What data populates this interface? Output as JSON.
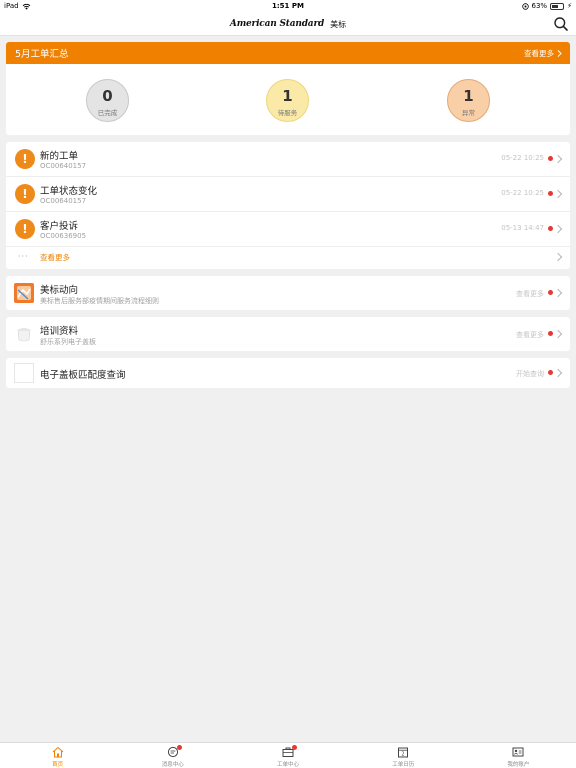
{
  "status_bar": {
    "device": "iPad",
    "time": "1:51 PM",
    "battery": "63%",
    "battery_level": 0.63
  },
  "navbar": {
    "brand_logo": "American Standard",
    "brand_cn": "美标"
  },
  "summary": {
    "title": "5月工单汇总",
    "more_label": "查看更多",
    "stats": [
      {
        "value": "0",
        "label": "已完成"
      },
      {
        "value": "1",
        "label": "待服务"
      },
      {
        "value": "1",
        "label": "异常"
      }
    ]
  },
  "orders": {
    "items": [
      {
        "title": "新的工单",
        "code": "OC00640157",
        "time": "05-22 10:25"
      },
      {
        "title": "工单状态变化",
        "code": "OC00640157",
        "time": "05-22 10:25"
      },
      {
        "title": "客户投诉",
        "code": "OC00636905",
        "time": "05-13 14:47"
      }
    ],
    "more_dots": "···",
    "more_label": "查看更多"
  },
  "news": {
    "title": "美标动向",
    "subtitle": "美标售后服务部疫情期间服务流程细则",
    "action": "查看更多"
  },
  "training": {
    "title": "培训资料",
    "subtitle": "舒乐系列电子盖板",
    "action": "查看更多"
  },
  "match": {
    "title": "电子盖板匹配度查询",
    "action": "开始查询"
  },
  "tabbar": {
    "tabs": [
      {
        "label": "首页",
        "icon": "home-icon"
      },
      {
        "label": "消息中心",
        "icon": "message-icon"
      },
      {
        "label": "工单中心",
        "icon": "briefcase-icon"
      },
      {
        "label": "工单日历",
        "icon": "calendar-icon"
      },
      {
        "label": "我的账户",
        "icon": "account-card-icon"
      }
    ]
  },
  "colors": {
    "accent": "#f08000",
    "badge": "#e53935",
    "warning": "#ee8a1a"
  }
}
